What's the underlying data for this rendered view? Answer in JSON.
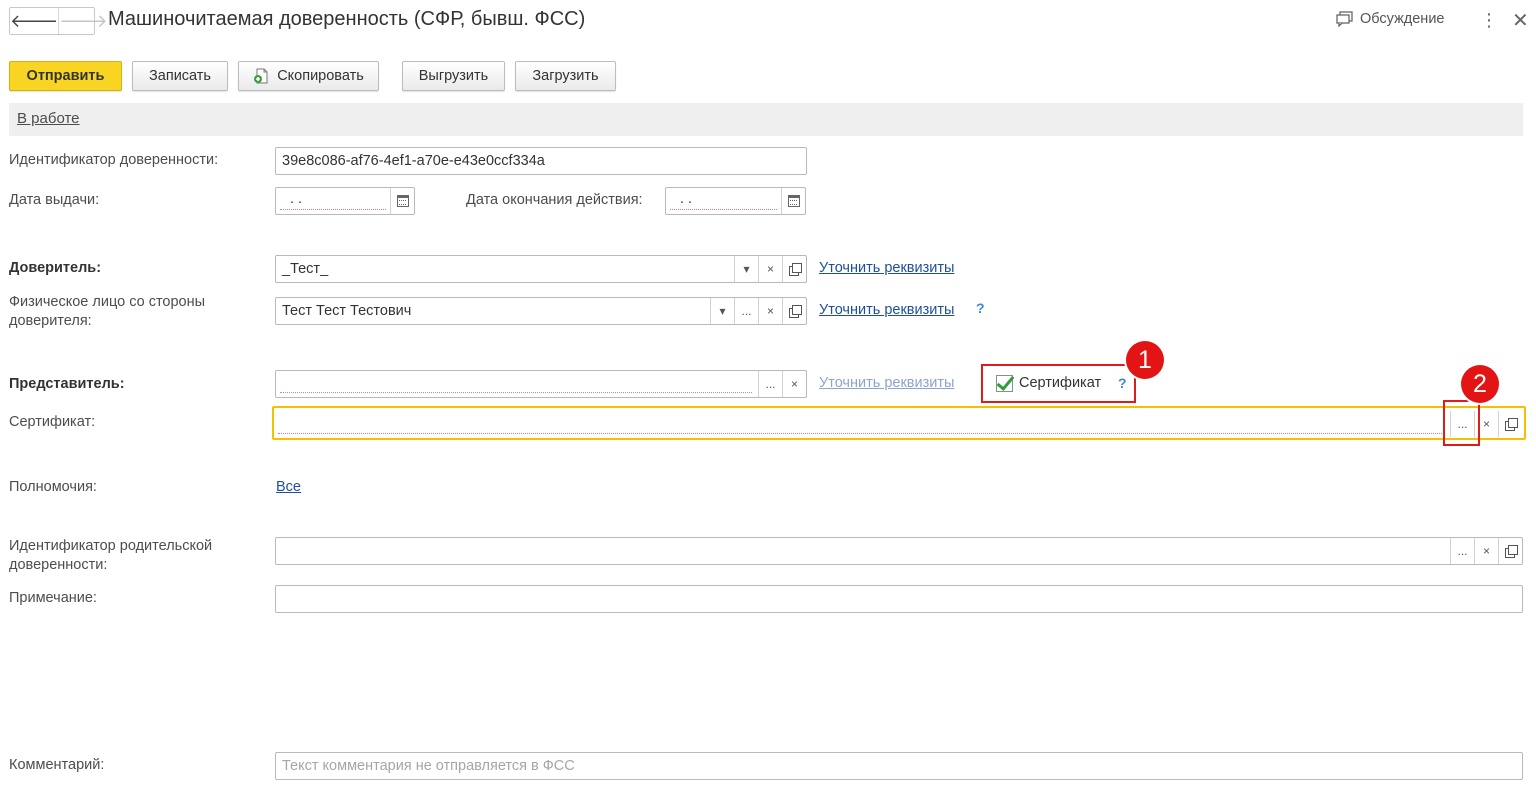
{
  "window": {
    "title": "Машиночитаемая доверенность (СФР, бывш. ФСС)",
    "back_glyph": "🡐",
    "forward_glyph": "🡒",
    "discussion_label": "Обсуждение",
    "menu_glyph": "⋮",
    "close_glyph": "✕"
  },
  "toolbar": {
    "send_label": "Отправить",
    "save_label": "Записать",
    "copy_label": "Скопировать",
    "export_label": "Выгрузить",
    "import_label": "Загрузить"
  },
  "status": {
    "label": "В работе"
  },
  "form": {
    "id_label": "Идентификатор доверенности:",
    "id_value": "39e8c086-af76-4ef1-a70e-e43e0ccf334a",
    "issue_date_label": "Дата выдачи:",
    "issue_date_value": ". .",
    "end_date_label": "Дата окончания действия:",
    "end_date_value": ". .",
    "principal_label": "Доверитель:",
    "principal_value": "_Тест_",
    "principal_link": "Уточнить реквизиты",
    "person_label_line1": "Физическое лицо со стороны",
    "person_label_line2": "доверителя:",
    "person_value": "Тест Тест Тестович",
    "person_link": "Уточнить реквизиты",
    "person_help": "?",
    "representative_label": "Представитель:",
    "representative_value": "",
    "representative_link": "Уточнить реквизиты",
    "certificate_checkbox_label": "Сертификат",
    "certificate_checkbox_checked": true,
    "certificate_help": "?",
    "certificate_label": "Сертификат:",
    "certificate_value": "",
    "powers_label": "Полномочия:",
    "powers_link": "Все",
    "parent_id_label_line1": "Идентификатор родительской",
    "parent_id_label_line2": "доверенности:",
    "parent_id_value": "",
    "note_label": "Примечание:",
    "note_value": "",
    "comment_label": "Комментарий:",
    "comment_placeholder": "Текст комментария не отправляется в ФСС"
  },
  "field_buttons": {
    "dropdown": "▾",
    "select": "...",
    "clear": "×"
  },
  "callouts": {
    "badge1": "1",
    "badge2": "2"
  },
  "colors": {
    "primary_button": "#f7d522",
    "focus_border": "#f2c200",
    "callout_red": "#e01b1b",
    "link": "#1f4f9c",
    "check_green": "#2e9c39"
  }
}
